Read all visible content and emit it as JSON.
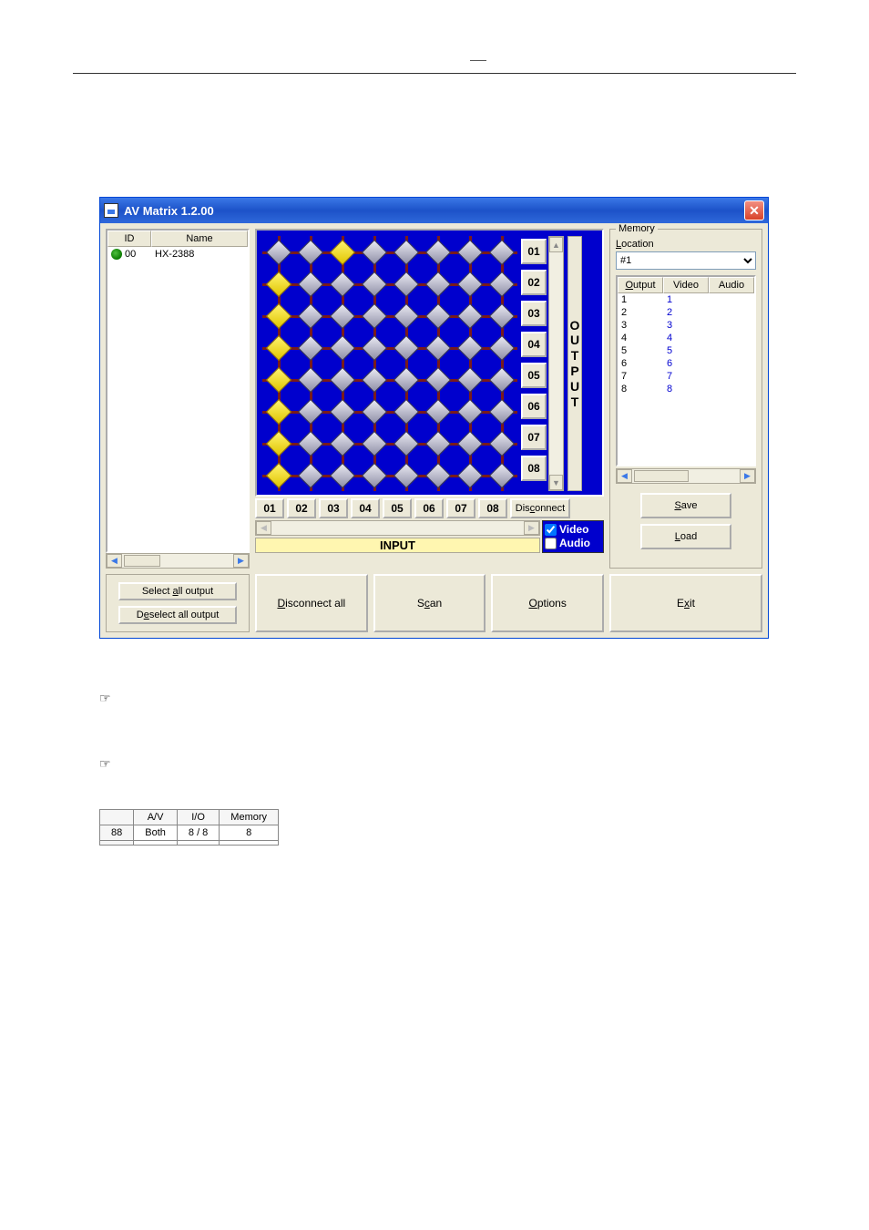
{
  "window": {
    "title": "AV Matrix 1.2.00",
    "close_label": "✕"
  },
  "device_list": {
    "headers": {
      "id": "ID",
      "name": "Name"
    },
    "rows": [
      {
        "id": "00",
        "name": "HX-2388"
      }
    ]
  },
  "matrix": {
    "grid_size": 8,
    "active_cells": [
      "1-3",
      "2-1",
      "3-1",
      "4-1",
      "5-1",
      "6-1",
      "7-1",
      "8-1"
    ],
    "output_labels": [
      "01",
      "02",
      "03",
      "04",
      "05",
      "06",
      "07",
      "08"
    ],
    "input_labels": [
      "01",
      "02",
      "03",
      "04",
      "05",
      "06",
      "07",
      "08"
    ],
    "output_word": "OUTPUT",
    "input_word": "INPUT",
    "disconnect_label": "Disconnect",
    "video_label": "Video",
    "audio_label": "Audio",
    "video_checked": true,
    "audio_checked": false
  },
  "memory": {
    "legend": "Memory",
    "location_label": "Location",
    "location_value": "#1",
    "headers": {
      "output": "Output",
      "video": "Video",
      "audio": "Audio"
    },
    "rows": [
      {
        "output": "1",
        "video": "1",
        "audio": ""
      },
      {
        "output": "2",
        "video": "2",
        "audio": ""
      },
      {
        "output": "3",
        "video": "3",
        "audio": ""
      },
      {
        "output": "4",
        "video": "4",
        "audio": ""
      },
      {
        "output": "5",
        "video": "5",
        "audio": ""
      },
      {
        "output": "6",
        "video": "6",
        "audio": ""
      },
      {
        "output": "7",
        "video": "7",
        "audio": ""
      },
      {
        "output": "8",
        "video": "8",
        "audio": ""
      }
    ],
    "save_label": "Save",
    "load_label": "Load"
  },
  "buttons": {
    "select_all": "Select all output",
    "deselect_all": "Deselect all output",
    "disconnect_all": "Disconnect all",
    "scan": "Scan",
    "options": "Options",
    "exit": "Exit"
  },
  "spec_table": {
    "headers": {
      "blank": "",
      "av": "A/V",
      "io": "I/O",
      "memory": "Memory"
    },
    "rows": [
      {
        "label": "88",
        "av": "Both",
        "io": "8 / 8",
        "memory": "8"
      },
      {
        "label": "",
        "av": "",
        "io": "",
        "memory": ""
      }
    ]
  },
  "pointers": {
    "glyph": "☞"
  }
}
